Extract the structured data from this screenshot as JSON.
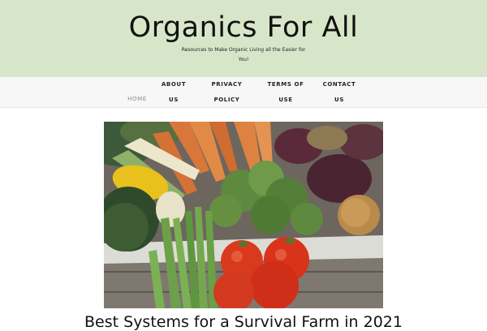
{
  "site": {
    "title": "Organics For All",
    "tagline": "Resources to Make Organic Living all the Easier for You!"
  },
  "nav": {
    "items": [
      {
        "label": "HOME"
      },
      {
        "label": "ABOUT US"
      },
      {
        "label": "PRIVACY POLICY"
      },
      {
        "label": "TERMS OF USE"
      },
      {
        "label": "CONTACT US"
      }
    ]
  },
  "post": {
    "title": "Best Systems for a Survival Farm in 2021"
  },
  "colors": {
    "header_bg": "#d7e6c9",
    "nav_bg": "#f7f7f7"
  }
}
